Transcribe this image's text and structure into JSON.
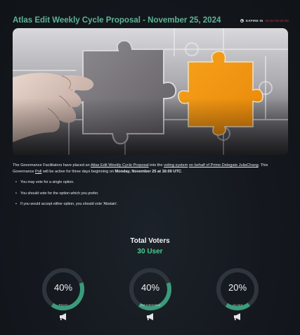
{
  "header": {
    "title": "Atlas Edit Weekly Cycle Proposal - November 25, 2024",
    "expire_label": "EXPIRE IN",
    "expire_value": "00:00:00:00:00",
    "accent_color": "#5fb493",
    "expire_color": "#d9313c"
  },
  "hero_image": {
    "description_icon": "puzzle-pieces-image"
  },
  "intro": {
    "p1": "The Governance Facilitators have placed an ",
    "link1": "Atlas Edit Weekly Cycle Proposal",
    "p2": " into the ",
    "link2": "voting system",
    "p3": " ",
    "link3": "on behalf of Prime Delegate JuliaChang",
    "p4": ". This Governance ",
    "link4": "Poll",
    "p5": " will be active for three days beginning on ",
    "date_strong": "Monday, November 25 at 16:00 UTC",
    "p6": "."
  },
  "bullets": [
    "You may vote for a single option.",
    "You should vote for the option which you prefer.",
    "If you would accept either option, you should vote 'Abstain'."
  ],
  "voters": {
    "title": "Total Voters",
    "count": "30 User",
    "count_color": "#43d08f"
  },
  "options": [
    {
      "label": "Reject",
      "percent_text": "40%",
      "fraction": 0.4,
      "vote_icon": "megaphone-icon"
    },
    {
      "label": "Not Interested",
      "percent_text": "40%",
      "fraction": 0.4,
      "vote_icon": "megaphone-icon"
    },
    {
      "label": "Accept",
      "percent_text": "20%",
      "fraction": 0.2,
      "vote_icon": "megaphone-icon"
    }
  ],
  "gauge_colors": {
    "track": "#2f353d",
    "fill": "#3a9c7a"
  }
}
